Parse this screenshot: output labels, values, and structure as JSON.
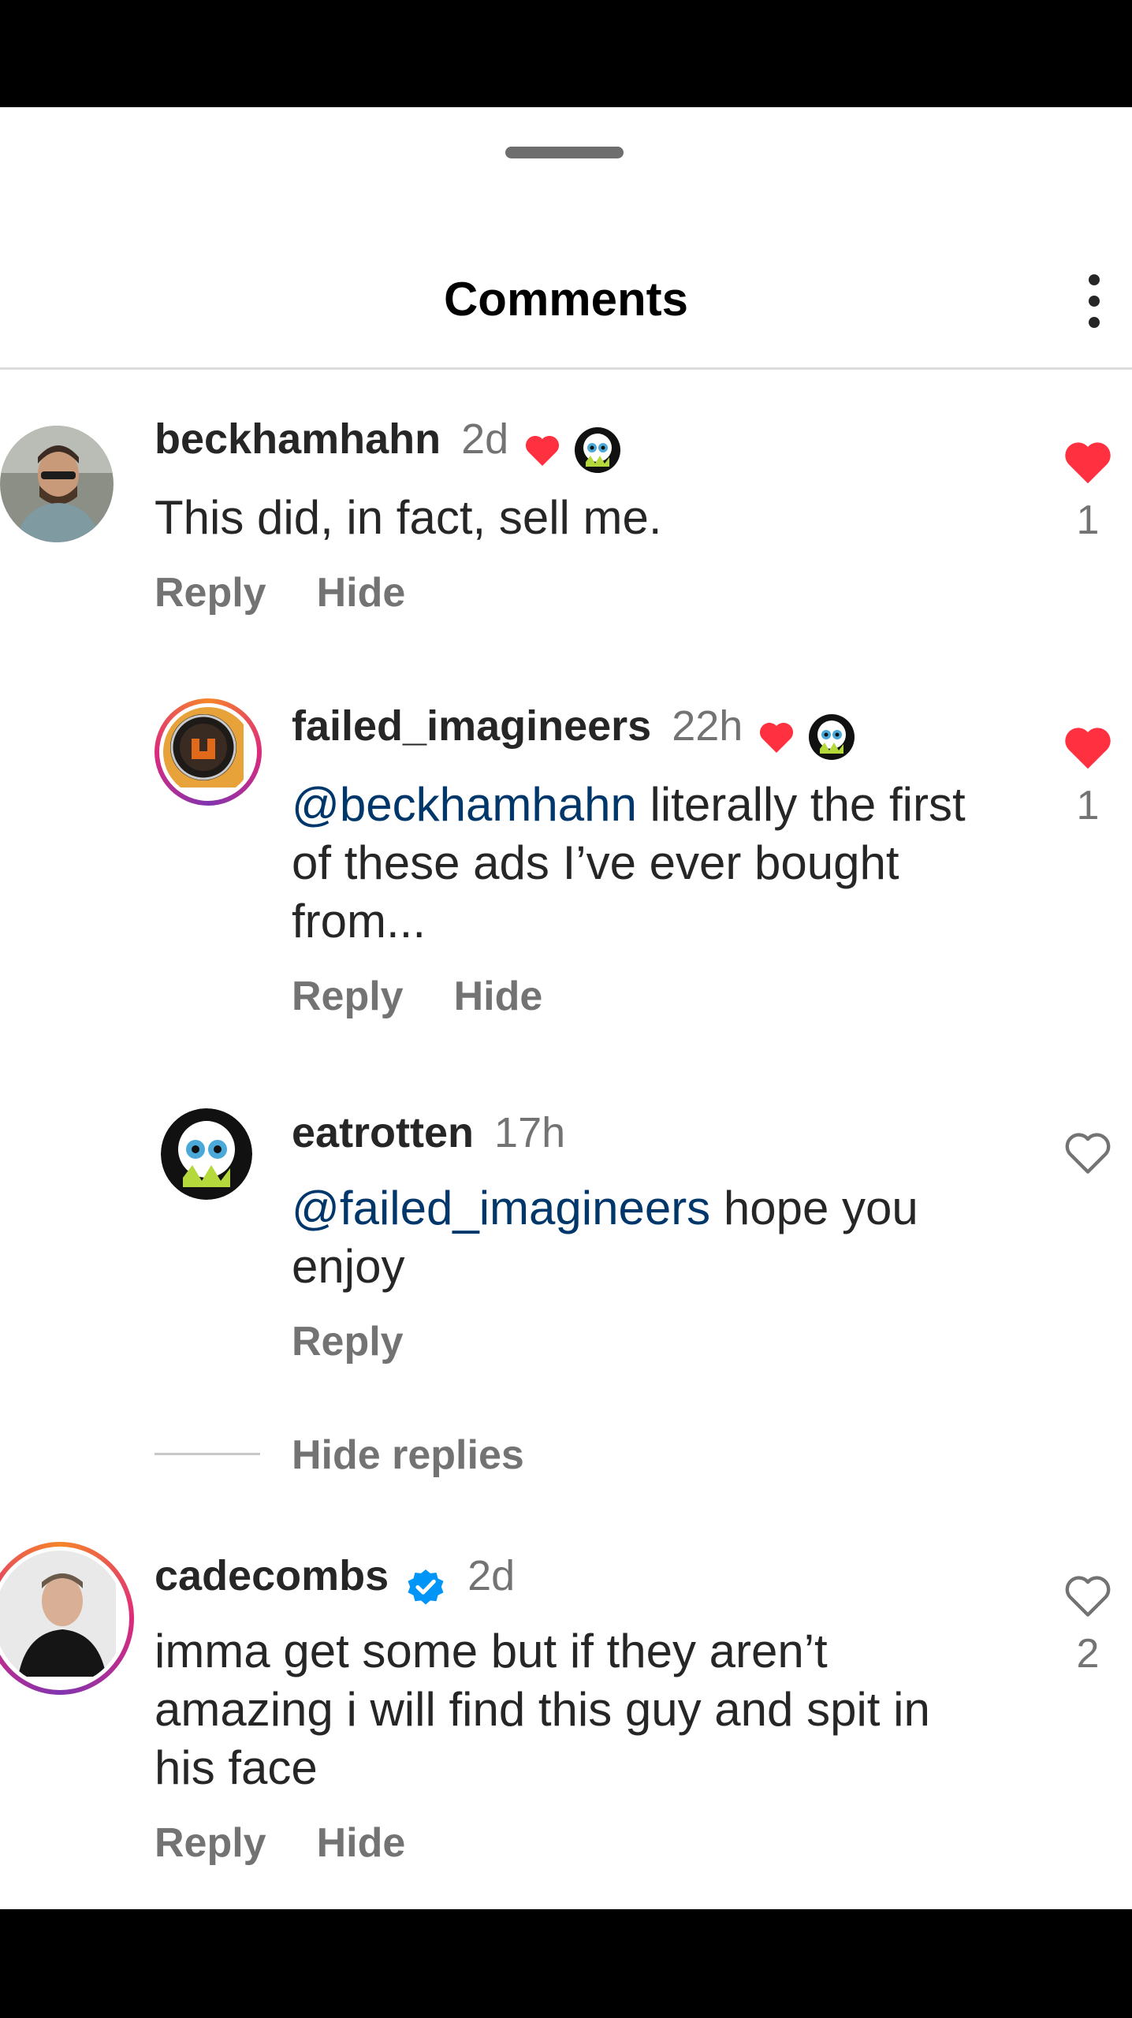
{
  "header": {
    "title": "Comments",
    "more_icon": "more-vertical-icon"
  },
  "comments": [
    {
      "username": "beckhamhahn",
      "time": "2d",
      "creator_liked": true,
      "text_plain": "This did, in fact, sell me.",
      "actions": {
        "reply": "Reply",
        "hide": "Hide"
      },
      "liked": true,
      "like_count": "1"
    },
    {
      "username": "failed_imagineers",
      "time": "22h",
      "creator_liked": true,
      "mention": "@beckhamhahn",
      "text_line1": " literally the first",
      "text_line2": "of these ads I’ve ever bought",
      "text_line3": "from...",
      "actions": {
        "reply": "Reply",
        "hide": "Hide"
      },
      "liked": true,
      "like_count": "1"
    },
    {
      "username": "eatrotten",
      "time": "17h",
      "mention": "@failed_imagineers",
      "text_line1": " hope you",
      "text_line2": "enjoy",
      "actions": {
        "reply": "Reply"
      },
      "liked": false
    },
    {
      "username": "cadecombs",
      "verified": true,
      "time": "2d",
      "text_line1": "imma get some but if they aren’t",
      "text_line2": "amazing i will find this guy and spit in",
      "text_line3": "his face",
      "actions": {
        "reply": "Reply",
        "hide": "Hide"
      },
      "liked": false,
      "like_count": "2"
    }
  ],
  "thread": {
    "hide_replies": "Hide replies"
  },
  "colors": {
    "like_red": "#ff3040",
    "mention_blue": "#00376b",
    "verified_blue": "#0095f6",
    "muted_gray": "#737373"
  }
}
